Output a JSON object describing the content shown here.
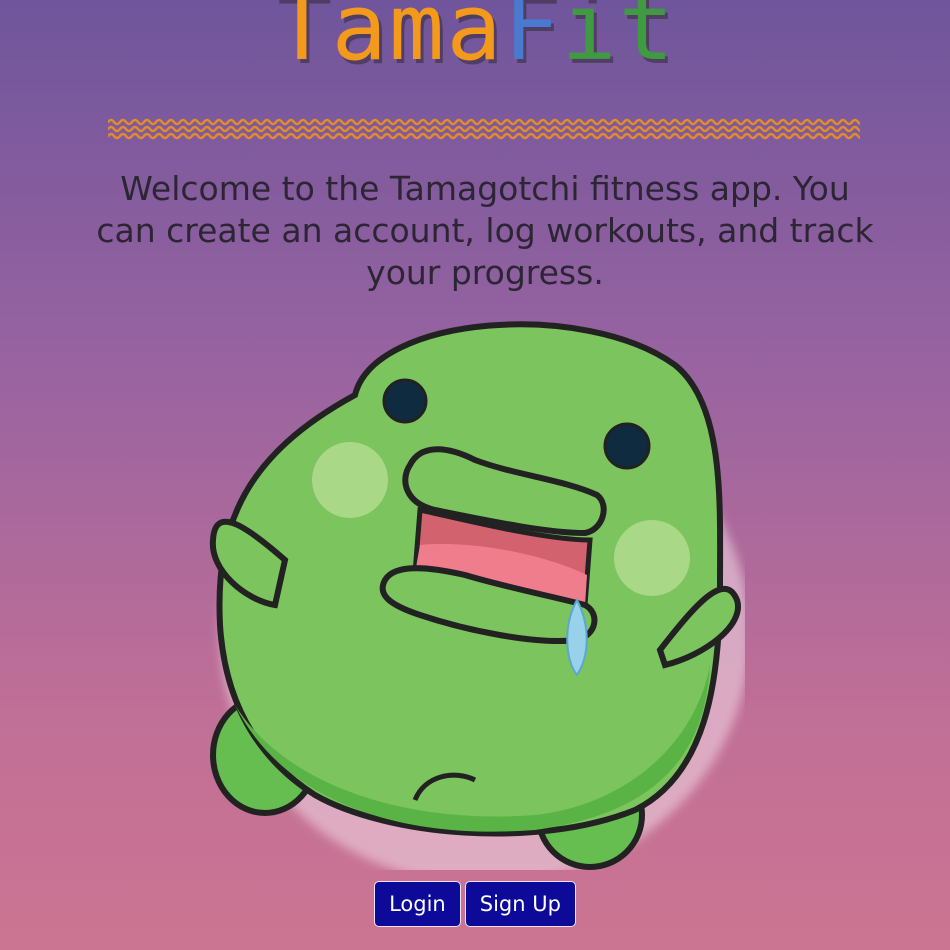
{
  "app": {
    "logo": {
      "part1": "Tama",
      "part2": "F",
      "part3": "it"
    },
    "colors": {
      "logo_orange": "#f39a1c",
      "logo_blue": "#4a7ad0",
      "logo_green": "#3f9a42",
      "divider_orange": "#e28b2a",
      "button_bg": "#0d0a9a",
      "background_top": "#6f559c",
      "background_bottom": "#cc7592"
    }
  },
  "main": {
    "welcome_text": "Welcome to the Tamagotchi fitness app. You can create an account, log workouts, and track your progress.",
    "mascot_icon": "green-tamagotchi-character"
  },
  "actions": {
    "login_label": "Login",
    "signup_label": "Sign Up"
  }
}
